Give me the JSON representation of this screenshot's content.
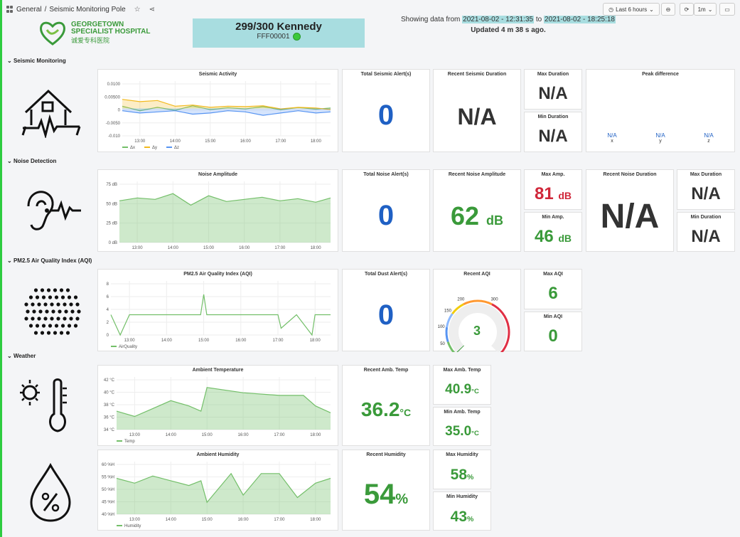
{
  "breadcrumb": {
    "folder": "General",
    "separator": "/",
    "dashboard": "Seismic Monitoring Pole"
  },
  "controls": {
    "time_range": "Last 6 hours",
    "refresh_interval": "1m"
  },
  "logo": {
    "line1": "GEORGETOWN",
    "line2": "SPECIALIST HOSPITAL",
    "line3": "诚爱专科医院"
  },
  "device": {
    "name": "299/300 Kennedy",
    "id": "FFF00001",
    "status_color": "#3cc93c"
  },
  "range": {
    "prefix": "Showing data from",
    "from": "2021-08-02 - 12:31:35",
    "mid": "to",
    "to": "2021-08-02 - 18:25:18",
    "updated": "Updated 4 m 38 s ago."
  },
  "sections": {
    "seismic": "Seismic Monitoring",
    "noise": "Noise Detection",
    "aqi": "PM2.5 Air Quality Index (AQI)",
    "weather": "Weather"
  },
  "seismic": {
    "chart_title": "Seismic Activity",
    "total_alerts_title": "Total Seismic Alert(s)",
    "total_alerts": "0",
    "recent_duration_title": "Recent Seismic Duration",
    "recent_duration": "N/A",
    "max_duration_title": "Max Duration",
    "max_duration": "N/A",
    "min_duration_title": "Min Duration",
    "min_duration": "N/A",
    "peak_title": "Peak difference",
    "peak": [
      {
        "value": "N/A",
        "axis": "x"
      },
      {
        "value": "N/A",
        "axis": "y"
      },
      {
        "value": "N/A",
        "axis": "z"
      }
    ]
  },
  "noise": {
    "chart_title": "Noise Amplitude",
    "total_alerts_title": "Total Noise Alert(s)",
    "total_alerts": "0",
    "recent_amp_title": "Recent Noise Amplitude",
    "recent_amp": "62",
    "recent_amp_unit": "dB",
    "max_amp_title": "Max Amp.",
    "max_amp": "81",
    "max_amp_unit": "dB",
    "min_amp_title": "Min Amp.",
    "min_amp": "46",
    "min_amp_unit": "dB",
    "recent_duration_title": "Recent Noise Duration",
    "recent_duration": "N/A",
    "max_duration_title": "Max Duration",
    "max_duration": "N/A",
    "min_duration_title": "Min Duration",
    "min_duration": "N/A"
  },
  "aqi": {
    "chart_title": "PM2.5 Air Quality Index (AQI)",
    "total_alerts_title": "Total Dust Alert(s)",
    "total_alerts": "0",
    "recent_title": "Recent AQI",
    "recent": "3",
    "gauge_ticks": [
      "0",
      "50",
      "100",
      "150",
      "200",
      "300",
      "500"
    ],
    "max_title": "Max AQI",
    "max": "6",
    "min_title": "Min AQI",
    "min": "0"
  },
  "weather": {
    "temp_chart_title": "Ambient Temperature",
    "recent_temp_title": "Recent Amb. Temp",
    "recent_temp": "36.2",
    "temp_unit": "°C",
    "max_temp_title": "Max Amb. Temp",
    "max_temp": "40.9",
    "min_temp_title": "Min Amb. Temp",
    "min_temp": "35.0",
    "hum_chart_title": "Ambient Humidity",
    "recent_hum_title": "Recent Humidity",
    "recent_hum": "54",
    "hum_unit": "%",
    "max_hum_title": "Max Humidity",
    "max_hum": "58",
    "min_hum_title": "Min Humidity",
    "min_hum": "43"
  },
  "colors": {
    "accent_blue": "#1f60c4",
    "green": "#3a9a3a",
    "red": "#d0273a",
    "series_green": "#73bf69",
    "series_yellow": "#f2b91d",
    "series_blue": "#5794f2"
  },
  "chart_data": [
    {
      "type": "line",
      "title": "Seismic Activity",
      "x": [
        "12:30",
        "13:00",
        "13:30",
        "14:00",
        "14:30",
        "15:00",
        "15:30",
        "16:00",
        "16:30",
        "17:00",
        "17:30",
        "18:00",
        "18:25"
      ],
      "xticks": [
        "13:00",
        "14:00",
        "15:00",
        "16:00",
        "17:00",
        "18:00"
      ],
      "yticks": [
        "0.0100",
        "0.00500",
        "0",
        "-0.0050",
        "-0.010"
      ],
      "ylim": [
        -0.012,
        0.012
      ],
      "series": [
        {
          "name": "Δx",
          "color": "#73bf69",
          "values": [
            0.001,
            -0.001,
            0.0005,
            -0.0008,
            0.0012,
            -0.0005,
            0.0003,
            -0.0002,
            0.0008,
            -0.0006,
            0.0004,
            -0.0003,
            0.0002
          ]
        },
        {
          "name": "Δy",
          "color": "#f2b91d",
          "values": [
            0.004,
            0.003,
            0.0035,
            0.001,
            0.0015,
            0.0005,
            0.001,
            0.0008,
            0.0012,
            -0.0002,
            0.0005,
            0.0002,
            -0.0005
          ]
        },
        {
          "name": "Δz",
          "color": "#5794f2",
          "values": [
            -0.001,
            -0.002,
            -0.0015,
            -0.001,
            -0.0025,
            -0.002,
            -0.001,
            -0.0015,
            -0.003,
            -0.002,
            -0.001,
            -0.002,
            -0.0015
          ]
        }
      ]
    },
    {
      "type": "area",
      "title": "Noise Amplitude",
      "x": [
        "12:30",
        "13:00",
        "13:30",
        "14:00",
        "14:30",
        "15:00",
        "15:30",
        "16:00",
        "16:30",
        "17:00",
        "17:30",
        "18:00",
        "18:25"
      ],
      "xticks": [
        "13:00",
        "14:00",
        "15:00",
        "16:00",
        "17:00",
        "18:00"
      ],
      "yticks": [
        "75 dB",
        "50 dB",
        "25 dB",
        "0 dB"
      ],
      "ylim": [
        0,
        85
      ],
      "series": [
        {
          "name": "Noise",
          "values": [
            58,
            62,
            60,
            68,
            52,
            65,
            57,
            60,
            63,
            58,
            61,
            56,
            62
          ]
        }
      ]
    },
    {
      "type": "line",
      "title": "PM2.5 Air Quality Index (AQI)",
      "x": [
        "12:30",
        "12:45",
        "13:00",
        "13:30",
        "14:00",
        "14:30",
        "14:55",
        "15:00",
        "15:05",
        "15:30",
        "16:00",
        "16:30",
        "17:00",
        "17:05",
        "17:30",
        "17:55",
        "18:00",
        "18:25"
      ],
      "xticks": [
        "13:00",
        "14:00",
        "15:00",
        "16:00",
        "17:00",
        "18:00"
      ],
      "yticks": [
        "8",
        "6",
        "4",
        "2",
        "0"
      ],
      "ylim": [
        0,
        8
      ],
      "series": [
        {
          "name": "AirQuality",
          "color": "#73bf69",
          "values": [
            3,
            0,
            3,
            3,
            3,
            3,
            3,
            6,
            3,
            3,
            3,
            3,
            3,
            1,
            3,
            0,
            3,
            3
          ]
        }
      ]
    },
    {
      "type": "area",
      "title": "Ambient Temperature",
      "x": [
        "12:30",
        "13:00",
        "13:30",
        "14:00",
        "14:30",
        "14:50",
        "15:00",
        "16:00",
        "17:00",
        "17:40",
        "18:00",
        "18:25"
      ],
      "xticks": [
        "13:00",
        "14:00",
        "15:00",
        "16:00",
        "17:00",
        "18:00"
      ],
      "yticks": [
        "42 °C",
        "40 °C",
        "38 °C",
        "36 °C",
        "34 °C"
      ],
      "ylim": [
        33,
        43
      ],
      "series": [
        {
          "name": "Temp",
          "values": [
            36.5,
            35.5,
            37,
            38.5,
            37.5,
            36.5,
            41,
            40,
            39.5,
            39.5,
            37.5,
            36.2
          ]
        }
      ]
    },
    {
      "type": "area",
      "title": "Ambient Humidity",
      "x": [
        "12:30",
        "13:00",
        "13:30",
        "14:00",
        "14:30",
        "14:50",
        "15:00",
        "15:40",
        "16:00",
        "16:30",
        "17:00",
        "17:30",
        "18:00",
        "18:25"
      ],
      "xticks": [
        "13:00",
        "14:00",
        "15:00",
        "16:00",
        "17:00",
        "18:00"
      ],
      "yticks": [
        "60 %H",
        "55 %H",
        "50 %H",
        "45 %H",
        "40 %H"
      ],
      "ylim": [
        39,
        61
      ],
      "series": [
        {
          "name": "Humidity",
          "values": [
            54,
            52,
            55,
            53,
            51,
            53,
            44,
            56,
            47,
            56,
            56,
            46,
            52,
            54
          ]
        }
      ]
    }
  ]
}
